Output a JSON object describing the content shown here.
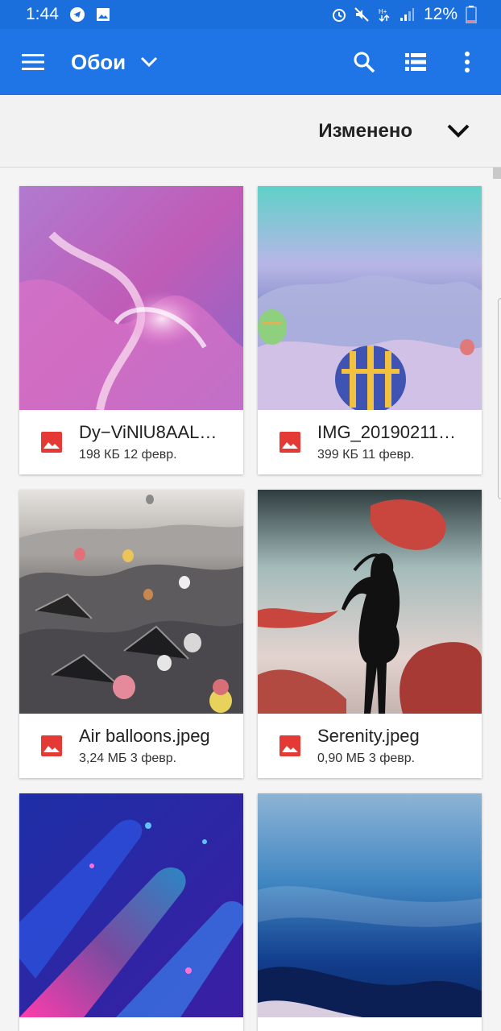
{
  "status_bar": {
    "time": "1:44",
    "battery": "12%",
    "icons_left": [
      "telegram-icon",
      "image-icon"
    ],
    "icons_right": [
      "alarm-icon",
      "mute-icon",
      "data-icon",
      "signal-icon",
      "battery-icon"
    ]
  },
  "app_bar": {
    "title": "Обои",
    "icons": [
      "menu-icon",
      "chevron-down-icon",
      "search-icon",
      "list-view-icon",
      "more-vert-icon"
    ]
  },
  "sort": {
    "label": "Изменено"
  },
  "files": [
    {
      "name": "Dy−ViNlU8AAL…",
      "meta": "198 КБ 12 февр."
    },
    {
      "name": "IMG_20190211…",
      "meta": "399 КБ 11 февр."
    },
    {
      "name": "Air balloons.jpeg",
      "meta": "3,24 МБ 3 февр."
    },
    {
      "name": "Serenity.jpeg",
      "meta": "0,90 МБ 3 февр."
    },
    {
      "name": "",
      "meta": ""
    },
    {
      "name": "",
      "meta": ""
    }
  ],
  "colors": {
    "app_bar": "#1f74e6",
    "status_bar": "#1b6fdc",
    "file_icon": "#e53935"
  }
}
